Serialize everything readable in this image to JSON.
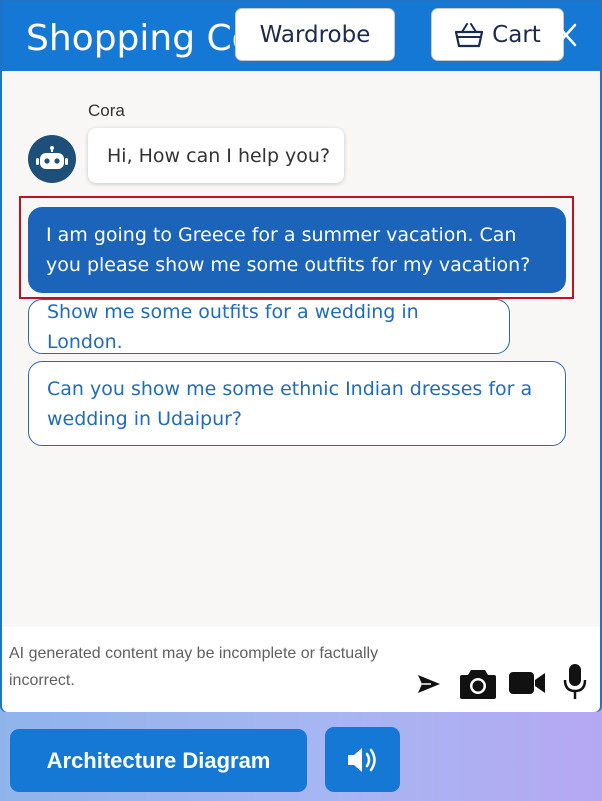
{
  "header": {
    "title": "Shopping Copilot",
    "wardrobe_label": "Wardrobe",
    "cart_label": "Cart",
    "cart_icon": "shopping-basket-icon",
    "close_icon": "close-icon"
  },
  "chat": {
    "bot_name": "Cora",
    "bot_avatar_icon": "robot-icon",
    "greeting": "Hi, How can I help you?",
    "suggestions": [
      "I am going to Greece for a summer vacation. Can you please show me some outfits for my vacation?",
      "Show me some outfits for a wedding in London.",
      "Can you show me some ethnic Indian dresses for a wedding in Udaipur?"
    ]
  },
  "input": {
    "disclaimer": "AI generated content may be incomplete or factually incorrect.",
    "icons": [
      "send-icon",
      "camera-icon",
      "video-icon",
      "microphone-icon"
    ]
  },
  "footer": {
    "architecture_label": "Architecture Diagram",
    "speaker_icon": "speaker-icon"
  },
  "colors": {
    "primary": "#1478d4",
    "selected_suggestion": "#1c64b9",
    "highlight": "#c1121f"
  }
}
